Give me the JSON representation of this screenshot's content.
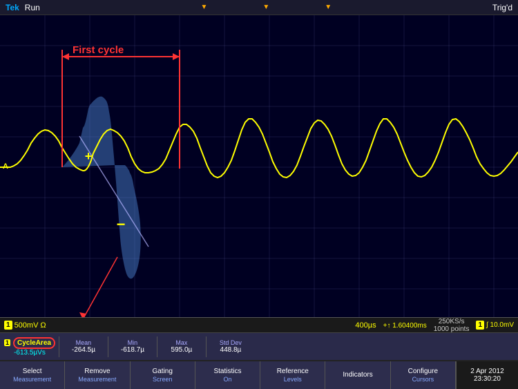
{
  "header": {
    "brand": "Tek",
    "run_status": "Run",
    "trig_status": "Trig'd",
    "markers": [
      "▼",
      "▼",
      "▼"
    ]
  },
  "channel": {
    "label": "1",
    "marker": "A"
  },
  "waveform": {
    "first_cycle_label": "First cycle"
  },
  "bottom_info": {
    "ch1_box": "1",
    "voltage": "500mV",
    "omega": "Ω",
    "timescale": "400µs",
    "time_increment": "+↑ 1.60400ms",
    "sample_rate": "250KS/s",
    "points": "1000 points",
    "ch1_box2": "1",
    "freq": "∫ 10.0mV"
  },
  "measurement": {
    "label": "CycleArea",
    "value": "-613.5µVs",
    "mean_label": "Mean",
    "mean_value": "-264.5µ",
    "min_label": "Min",
    "min_value": "-618.7µ",
    "max_label": "Max",
    "max_value": "595.0µ",
    "stddev_label": "Std Dev",
    "stddev_value": "448.8µ"
  },
  "buttons": [
    {
      "id": "select-measurement",
      "line1": "Select",
      "line2": "Measurement"
    },
    {
      "id": "remove-measurement",
      "line1": "Remove",
      "line2": "Measurement"
    },
    {
      "id": "gating-screen",
      "line1": "Gating",
      "line2": "Screen"
    },
    {
      "id": "statistics-on",
      "line1": "Statistics",
      "line2": "On"
    },
    {
      "id": "reference-levels",
      "line1": "Reference",
      "line2": "Levels"
    },
    {
      "id": "indicators",
      "line1": "Indicators",
      "line2": ""
    },
    {
      "id": "configure-cursors",
      "line1": "Configure",
      "line2": "Cursors"
    }
  ],
  "datetime": {
    "date": "2 Apr 2012",
    "time": "23:30:20"
  },
  "colors": {
    "accent": "#ffff00",
    "red": "#ff3333",
    "blue_fill": "rgba(80,140,220,0.5)",
    "grid": "rgba(80,80,140,0.5)",
    "bg": "#000022"
  }
}
